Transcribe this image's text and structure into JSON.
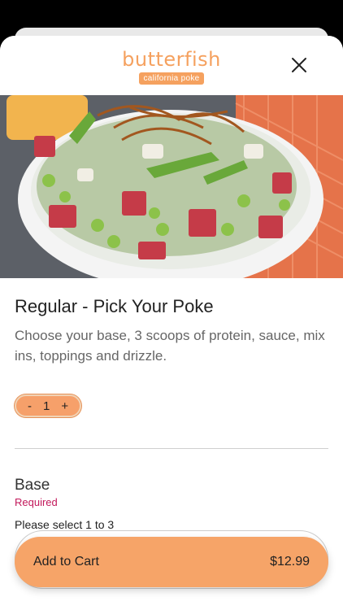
{
  "brand": {
    "name": "butterfish",
    "tagline": "california poke"
  },
  "colors": {
    "accent": "#f6a468",
    "required": "#c2185b"
  },
  "icons": {
    "close": "close-icon"
  },
  "item": {
    "title": "Regular - Pick Your Poke",
    "description": "Choose your base, 3 scoops of protein, sauce, mix ins, toppings and drizzle."
  },
  "quantity": {
    "minus": "-",
    "value": "1",
    "plus": "+"
  },
  "section": {
    "title": "Base",
    "required": "Required",
    "hint": "Please select 1 to 3"
  },
  "cart": {
    "label": "Add to Cart",
    "price": "$12.99"
  }
}
